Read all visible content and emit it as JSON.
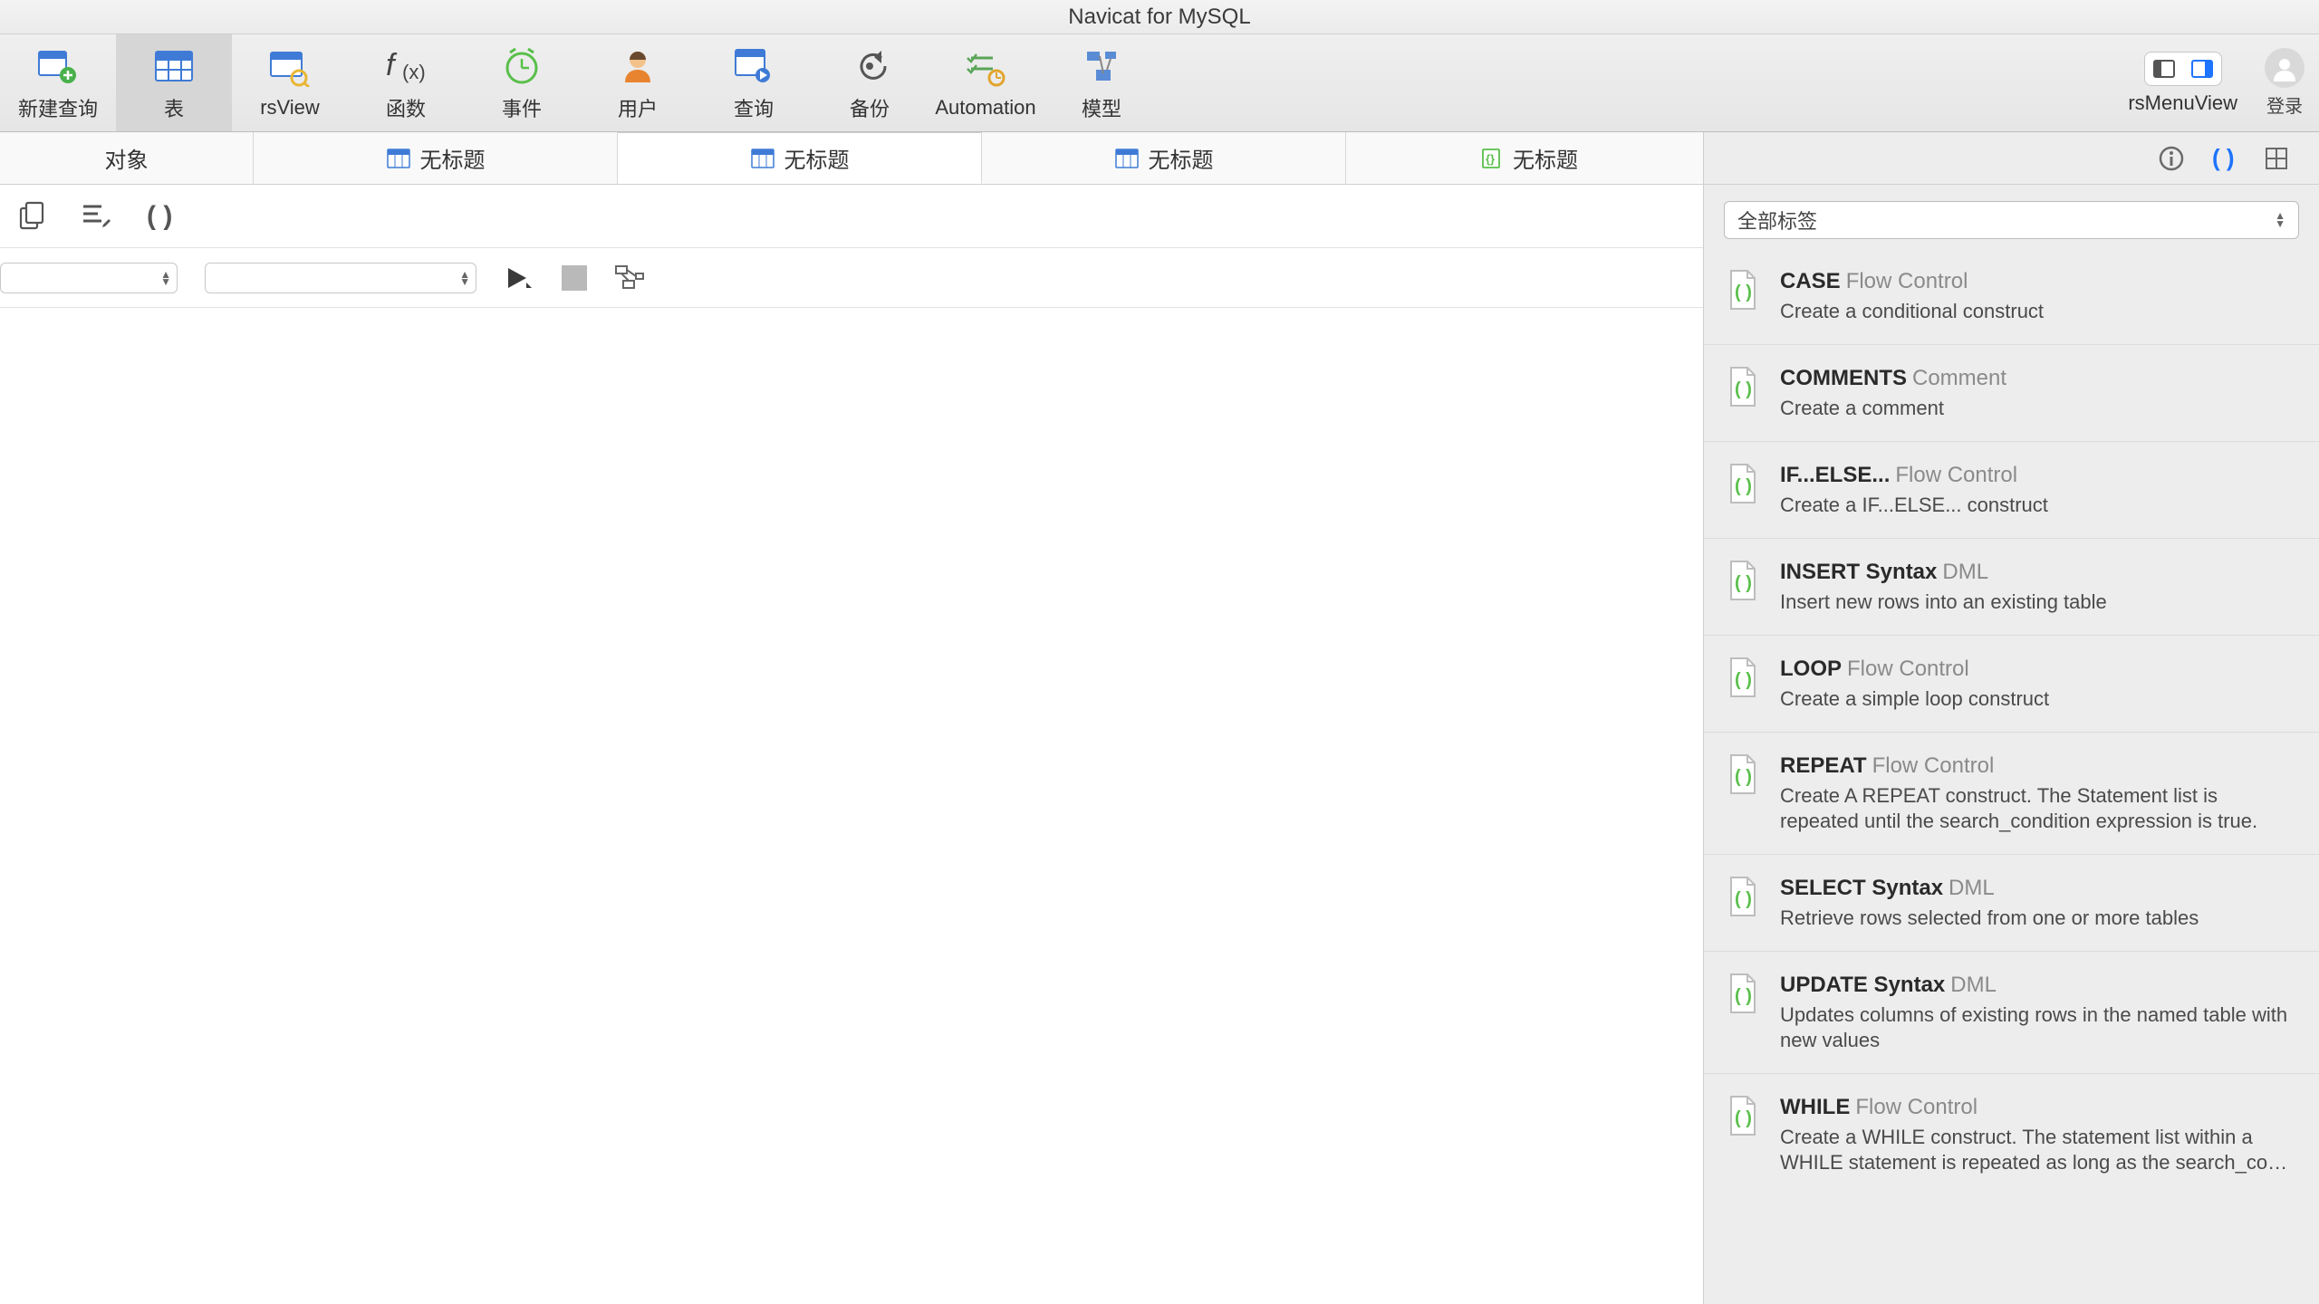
{
  "window": {
    "title": "Navicat for MySQL"
  },
  "toolbar": {
    "items": [
      {
        "label": "新建查询"
      },
      {
        "label": "表"
      },
      {
        "label": "rsView"
      },
      {
        "label": "函数"
      },
      {
        "label": "事件"
      },
      {
        "label": "用户"
      },
      {
        "label": "查询"
      },
      {
        "label": "备份"
      },
      {
        "label": "Automation"
      },
      {
        "label": "模型"
      }
    ],
    "menu_view_label": "rsMenuView",
    "login_label": "登录"
  },
  "subtabs": {
    "t0": "对象",
    "untitled": "无标题"
  },
  "side": {
    "tag_select": "全部标签",
    "snippets": [
      {
        "name": "CASE",
        "cat": "Flow Control",
        "desc": "Create a conditional construct"
      },
      {
        "name": "COMMENTS",
        "cat": "Comment",
        "desc": "Create a comment"
      },
      {
        "name": "IF...ELSE...",
        "cat": "Flow Control",
        "desc": "Create a IF...ELSE... construct"
      },
      {
        "name": "INSERT Syntax",
        "cat": "DML",
        "desc": "Insert new rows into an existing table"
      },
      {
        "name": "LOOP",
        "cat": "Flow Control",
        "desc": "Create a simple loop construct"
      },
      {
        "name": "REPEAT",
        "cat": "Flow Control",
        "desc": "Create A REPEAT construct. The Statement list is repeated until the search_condition expression is true."
      },
      {
        "name": "SELECT Syntax",
        "cat": "DML",
        "desc": "Retrieve rows selected from one or more tables"
      },
      {
        "name": "UPDATE Syntax",
        "cat": "DML",
        "desc": "Updates columns of existing rows in the named table with new values"
      },
      {
        "name": "WHILE",
        "cat": "Flow Control",
        "desc": "Create a WHILE construct. The statement list within a WHILE statement is repeated as long as the search_co…"
      }
    ]
  }
}
